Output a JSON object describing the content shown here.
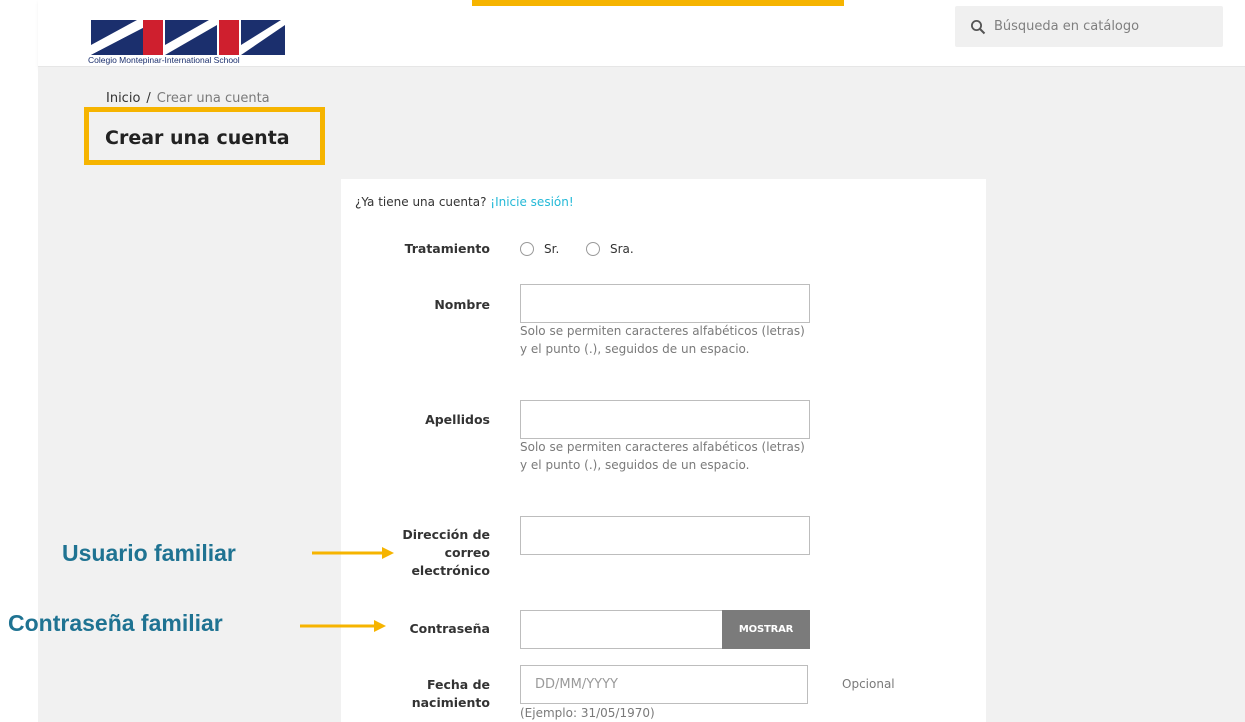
{
  "header": {
    "logo_caption": "Colegio Montepinar-International School",
    "search_placeholder": "Búsqueda en catálogo",
    "colors": {
      "highlight": "#f6b400",
      "logo_blue": "#1b2f6d",
      "logo_red": "#cf1f2e"
    }
  },
  "breadcrumb": {
    "home": "Inicio",
    "separator": "/",
    "current": "Crear una cuenta"
  },
  "page_title": "Crear una cuenta",
  "form": {
    "have_account_text": "¿Ya tiene una cuenta?",
    "login_link": "¡Inicie sesión!",
    "tratamiento_label": "Tratamiento",
    "options": [
      "Sr.",
      "Sra."
    ],
    "nombre_label": "Nombre",
    "nombre_help": "Solo se permiten caracteres alfabéticos (letras) y el punto (.), seguidos de un espacio.",
    "apellidos_label": "Apellidos",
    "apellidos_help": "Solo se permiten caracteres alfabéticos (letras) y el punto (.), seguidos de un espacio.",
    "email_label_1": "Dirección de",
    "email_label_2": "correo",
    "email_label_3": "electrónico",
    "password_label": "Contraseña",
    "show_button": "MOSTRAR",
    "birth_label_1": "Fecha de",
    "birth_label_2": "nacimiento",
    "birth_placeholder": "DD/MM/YYYY",
    "birth_optional": "Opcional",
    "birth_example": "(Ejemplo: 31/05/1970)"
  },
  "annotations": {
    "user": "Usuario familiar",
    "password": "Contraseña familiar",
    "color": "#1f7392",
    "arrow_color": "#f6b400"
  }
}
